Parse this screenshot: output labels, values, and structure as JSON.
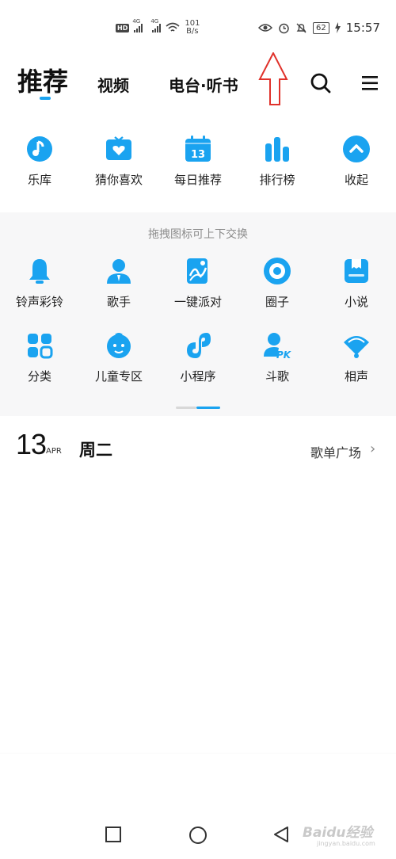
{
  "status_bar": {
    "hd": "HD",
    "signal_1": "4G",
    "signal_2": "4G",
    "speed_value": "101",
    "speed_unit": "B/s",
    "battery": "62",
    "time": "15:57"
  },
  "top_nav": {
    "tabs": [
      {
        "label": "推荐",
        "active": true
      },
      {
        "label": "视频"
      },
      {
        "label": "电台·听书"
      }
    ],
    "accent": "#1aa3f0",
    "arrow_color": "#e0322b"
  },
  "primary_items": [
    {
      "label": "乐库",
      "icon": "music-note-icon"
    },
    {
      "label": "猜你喜欢",
      "icon": "heart-box-icon"
    },
    {
      "label": "每日推荐",
      "icon": "calendar-13-icon",
      "icon_text": "13"
    },
    {
      "label": "排行榜",
      "icon": "bar-chart-icon"
    },
    {
      "label": "收起",
      "icon": "collapse-up-icon"
    }
  ],
  "drawer": {
    "hint": "拖拽图标可上下交换",
    "items": [
      {
        "label": "铃声彩铃",
        "icon": "bell-icon"
      },
      {
        "label": "歌手",
        "icon": "singer-icon"
      },
      {
        "label": "一键派对",
        "icon": "party-icon"
      },
      {
        "label": "圈子",
        "icon": "circle-ring-icon"
      },
      {
        "label": "小说",
        "icon": "book-icon"
      },
      {
        "label": "分类",
        "icon": "category-grid-icon"
      },
      {
        "label": "儿童专区",
        "icon": "child-face-icon"
      },
      {
        "label": "小程序",
        "icon": "mini-program-icon"
      },
      {
        "label": "斗歌",
        "icon": "pk-icon",
        "icon_text": "PK"
      },
      {
        "label": "相声",
        "icon": "fan-icon"
      }
    ]
  },
  "date_row": {
    "day": "13",
    "month": "APR",
    "weekday": "周二",
    "playlist_label": "歌单广场",
    "chevron": "›"
  },
  "watermark": {
    "text": "Baidu经验",
    "sub": "jingyan.baidu.com"
  }
}
